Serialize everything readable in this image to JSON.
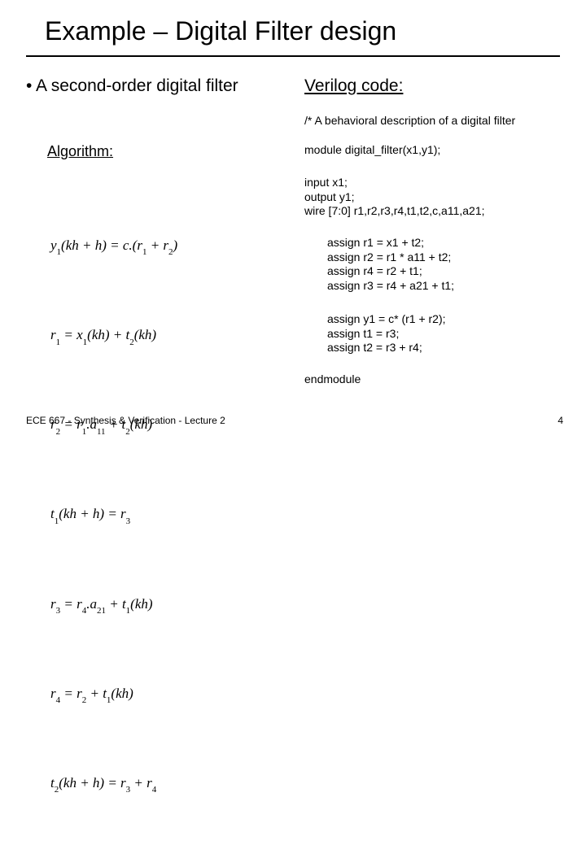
{
  "title": "Example – Digital Filter design",
  "bullet": "• A second-order digital filter",
  "verilog_heading": "Verilog code:",
  "comment": "/* A behavioral description of a digital filter",
  "algorithm_heading": "Algorithm:",
  "module_line": "module digital_filter(x1,y1);",
  "decls": "input x1;\noutput y1;\nwire [7:0] r1,r2,r3,r4,t1,t2,c,a11,a21;",
  "assign_block1": "assign r1 = x1 + t2;\nassign r2 = r1 * a11 + t2;\nassign r4 = r2 + t1;\nassign r3 = r4 + a21 + t1;",
  "assign_block2": "assign y1 = c* (r1 + r2);\nassign t1 = r3;\nassign t2 = r3 + r4;",
  "endmodule": "endmodule",
  "equations": {
    "e1": "y₁(kh + h) = c.(r₁ + r₂)",
    "e2": "r₁ = x₁(kh) + t₂(kh)",
    "e3": "r₂ = r₁.a₁₁ + t₂(kh)",
    "e4": "t₁(kh + h) = r₃",
    "e5": "r₃ = r₄.a₂₁ + t₁(kh)",
    "e6": "r₄ = r₂ + t₁(kh)",
    "e7": "t₂(kh + h) = r₃ + r₄"
  },
  "footer": "ECE 667 - Synthesis & Verification - Lecture 2",
  "page_number": "4"
}
